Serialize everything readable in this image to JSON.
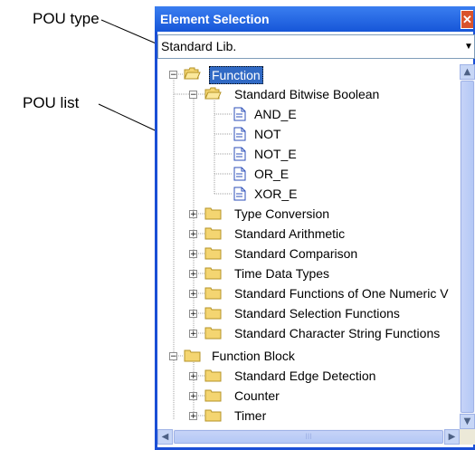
{
  "callouts": {
    "pou_type": "POU type",
    "pou_list": "POU list"
  },
  "window": {
    "title": "Element Selection",
    "close_glyph": "✕"
  },
  "pou_type_combo": {
    "value": "Standard Lib.",
    "arrow": "▼"
  },
  "tree": {
    "function": "Function",
    "bitwise_boolean": "Standard Bitwise Boolean",
    "and_e": "AND_E",
    "not": "NOT",
    "not_e": "NOT_E",
    "or_e": "OR_E",
    "xor_e": "XOR_E",
    "type_conversion": "Type Conversion",
    "arithmetic": "Standard Arithmetic",
    "comparison": "Standard Comparison",
    "time_data_types": "Time Data Types",
    "numeric": "Standard Functions of One Numeric V",
    "selection": "Standard Selection Functions",
    "string": "Standard Character String Functions",
    "function_block": "Function Block",
    "edge_detection": "Standard Edge Detection",
    "counter": "Counter",
    "timer": "Timer",
    "expanded_glyph": "−",
    "collapsed_glyph": "+"
  },
  "scrollbars": {
    "up": "▲",
    "down": "▼",
    "left": "◀",
    "right": "▶",
    "grip": "III"
  },
  "colors": {
    "title_bar": "#1656d8",
    "selection": "#316ac5",
    "folder": "#f4d571"
  }
}
